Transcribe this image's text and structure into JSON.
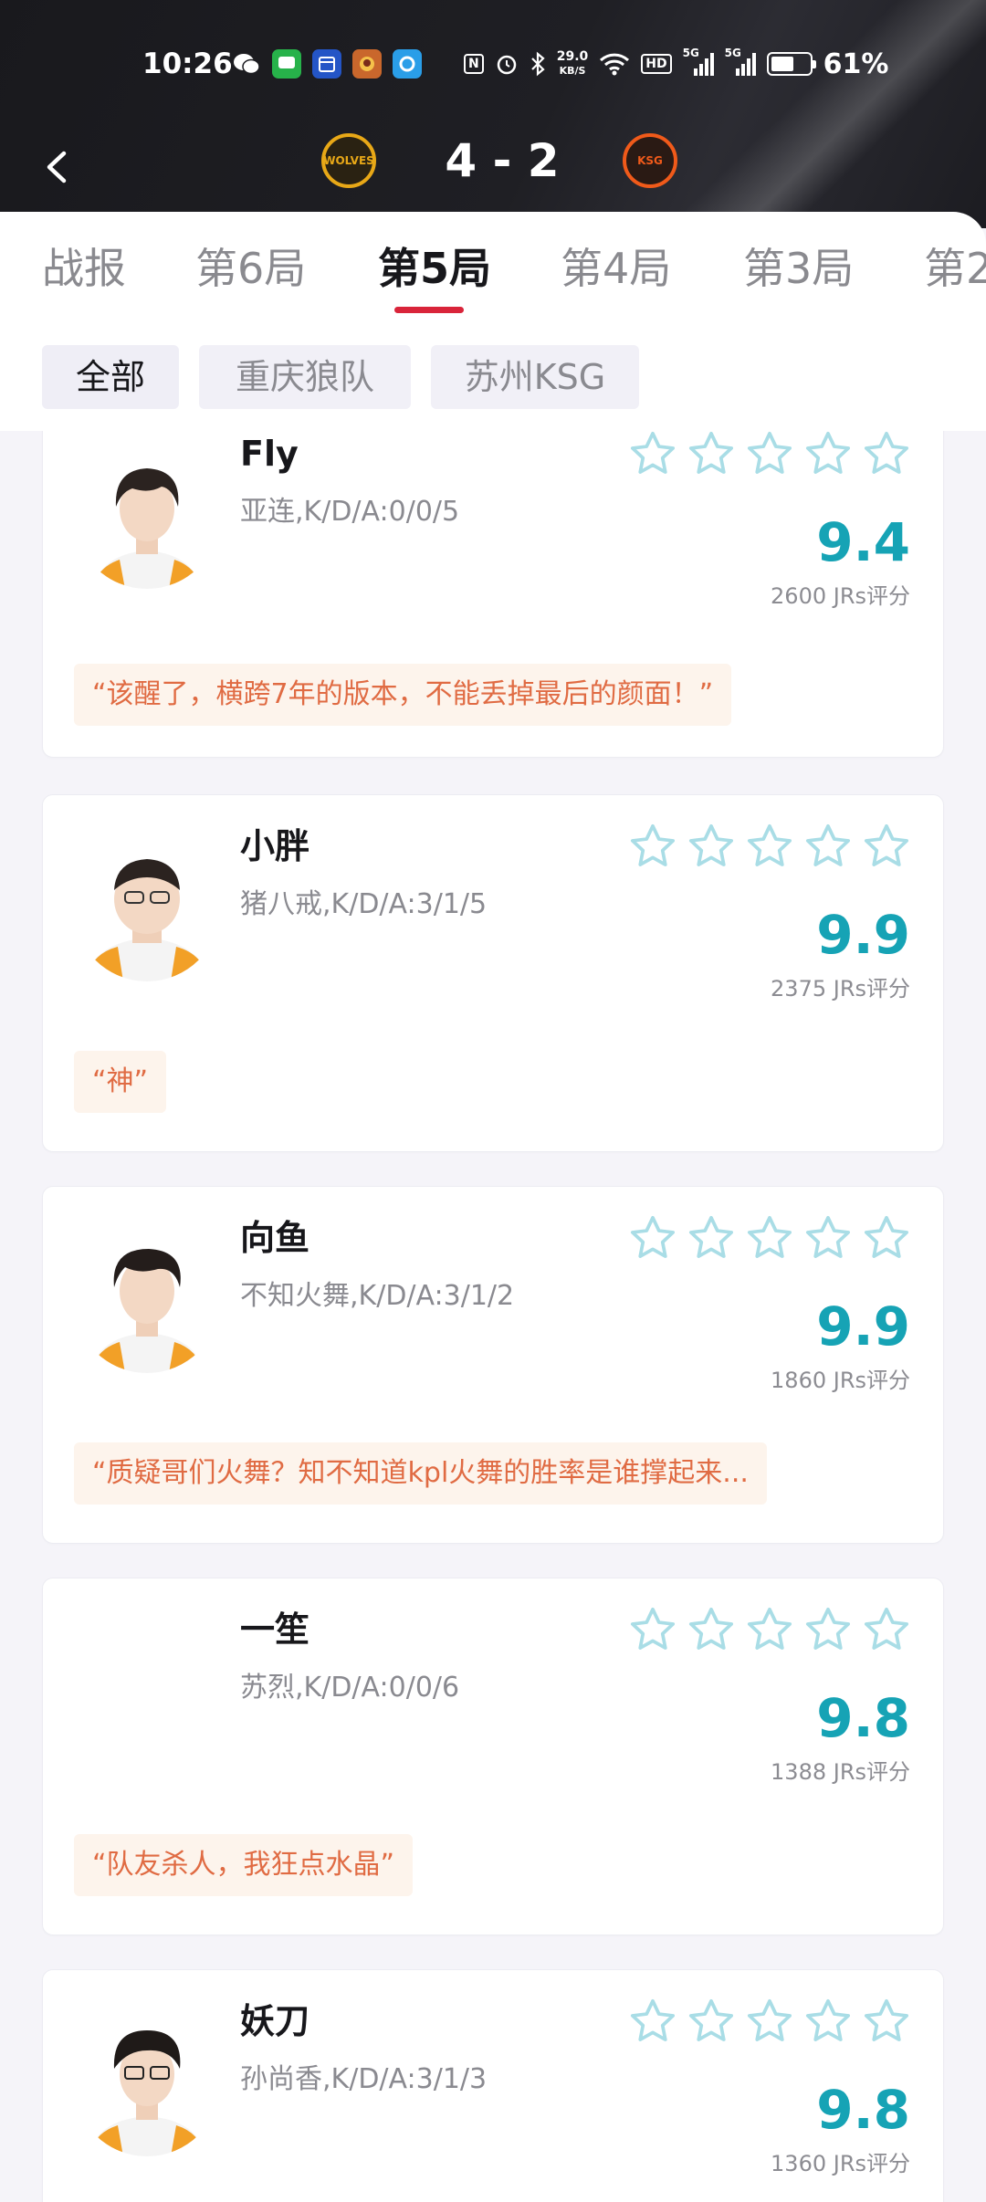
{
  "status_bar": {
    "time": "10:26",
    "net_speed_value": "29.0",
    "net_speed_unit": "KB/S",
    "hd_label": "HD",
    "signal_label_1": "5G",
    "signal_label_2": "5G",
    "battery_percent": "61%",
    "battery_level": 0.61
  },
  "header": {
    "score": "4 - 2",
    "team_left_logo": "WOLVES",
    "team_right_logo": "KSG"
  },
  "tabs": [
    {
      "label": "战报",
      "active": false
    },
    {
      "label": "第6局",
      "active": false
    },
    {
      "label": "第5局",
      "active": true
    },
    {
      "label": "第4局",
      "active": false
    },
    {
      "label": "第3局",
      "active": false
    },
    {
      "label": "第2",
      "active": false
    }
  ],
  "filters": [
    {
      "label": "全部",
      "active": true
    },
    {
      "label": "重庆狼队",
      "active": false
    },
    {
      "label": "苏州KSG",
      "active": false
    }
  ],
  "players": [
    {
      "name": "Fly",
      "stat": "亚连,K/D/A:0/0/5",
      "rating": "9.4",
      "count": "2600 JRs评分",
      "stars": 5,
      "quote": "“该醒了，横跨7年的版本，不能丢掉最后的颜面！”"
    },
    {
      "name": "小胖",
      "stat": "猪八戒,K/D/A:3/1/5",
      "rating": "9.9",
      "count": "2375 JRs评分",
      "stars": 5,
      "quote": "“神”"
    },
    {
      "name": "向鱼",
      "stat": "不知火舞,K/D/A:3/1/2",
      "rating": "9.9",
      "count": "1860 JRs评分",
      "stars": 5,
      "quote": "“质疑哥们火舞？知不知道kpl火舞的胜率是谁撑起来..."
    },
    {
      "name": "一笙",
      "stat": "苏烈,K/D/A:0/0/6",
      "rating": "9.8",
      "count": "1388 JRs评分",
      "stars": 5,
      "quote": "“队友杀人，我狂点水晶”"
    },
    {
      "name": "妖刀",
      "stat": "孙尚香,K/D/A:3/1/3",
      "rating": "9.8",
      "count": "1360 JRs评分",
      "stars": 5,
      "quote": ""
    }
  ],
  "colors": {
    "accent_red": "#d9243a",
    "rating_teal": "#16a3b5",
    "star_outline": "#a9dde6",
    "quote_text": "#e06b43",
    "quote_bg": "#fdf4ec"
  }
}
